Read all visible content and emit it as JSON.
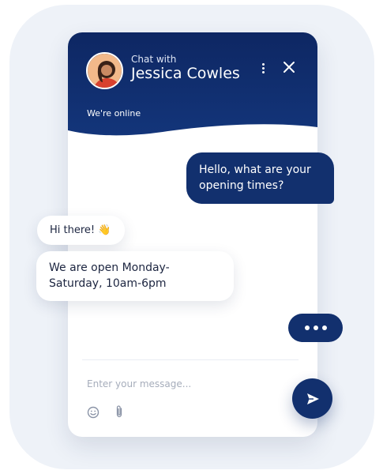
{
  "header": {
    "chat_with": "Chat with",
    "agent_name": "Jessica Cowles",
    "status": "We're online"
  },
  "messages": [
    {
      "from": "visitor",
      "text": "Hello, what are your opening times?"
    },
    {
      "from": "agent",
      "text": "Hi there! 👋"
    },
    {
      "from": "agent",
      "text": "We are open Monday-Saturday, 10am-6pm"
    }
  ],
  "composer": {
    "placeholder": "Enter your message..."
  },
  "icons": {
    "menu": "vertical-dots-icon",
    "close": "close-icon",
    "emoji": "emoji-icon",
    "attach": "paperclip-icon",
    "send": "send-icon",
    "typing": "typing-indicator-icon"
  },
  "colors": {
    "brand": "#12306e",
    "header_top": "#0e2763",
    "background": "#eef2f8"
  }
}
